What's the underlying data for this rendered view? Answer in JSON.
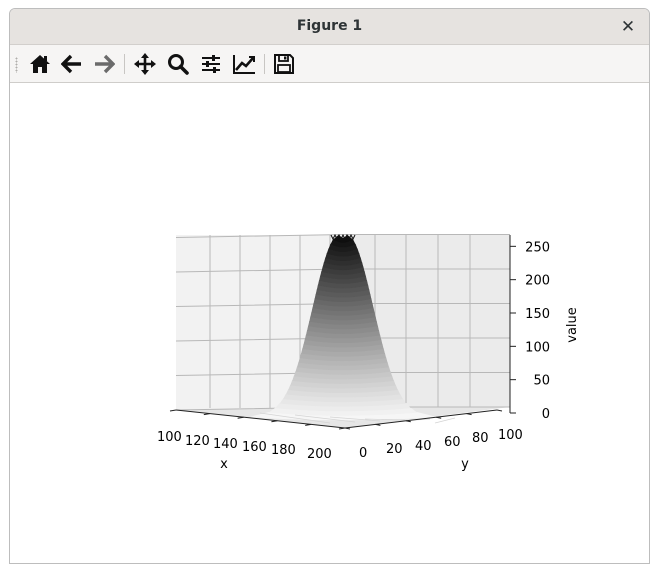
{
  "window": {
    "title": "Figure 1",
    "close_glyph": "✕"
  },
  "toolbar": {
    "buttons": [
      {
        "name": "home-button",
        "icon": "home-icon"
      },
      {
        "name": "back-button",
        "icon": "arrow-left-icon"
      },
      {
        "name": "forward-button",
        "icon": "arrow-right-icon"
      },
      {
        "name": "pan-button",
        "icon": "move-icon"
      },
      {
        "name": "zoom-button",
        "icon": "magnifier-icon"
      },
      {
        "name": "configure-subplots-button",
        "icon": "sliders-icon"
      },
      {
        "name": "edit-axes-button",
        "icon": "line-chart-icon"
      },
      {
        "name": "save-button",
        "icon": "floppy-disk-icon"
      }
    ]
  },
  "chart_data": {
    "type": "surface",
    "title": "",
    "xlabel": "x",
    "ylabel": "y",
    "zlabel": "value",
    "x_ticks": [
      "100",
      "120",
      "140",
      "160",
      "180",
      "200"
    ],
    "y_ticks": [
      "0",
      "20",
      "40",
      "60",
      "80",
      "100"
    ],
    "z_ticks": [
      "0",
      "50",
      "100",
      "150",
      "200",
      "250"
    ],
    "xlim": [
      100,
      200
    ],
    "ylim": [
      0,
      100
    ],
    "zlim": [
      0,
      255
    ],
    "grid": true,
    "colormap": "gray_r",
    "surface": {
      "shape": "gaussian peak",
      "peak_value": 255,
      "peak_x": 140,
      "peak_y": 50
    }
  }
}
